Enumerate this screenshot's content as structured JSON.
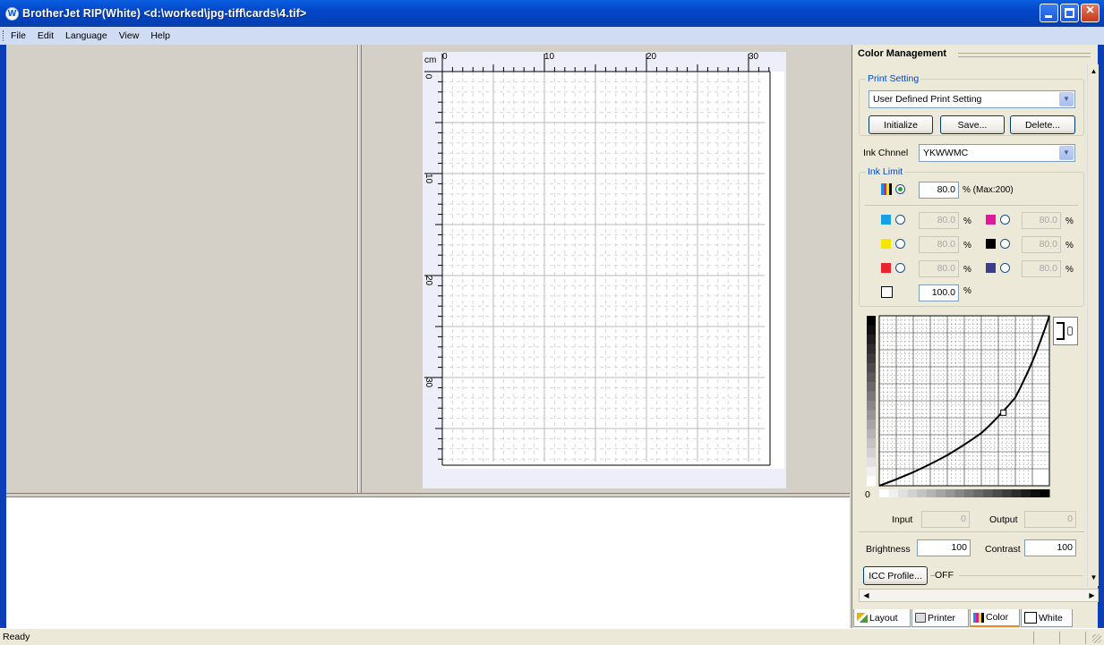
{
  "window": {
    "title": "BrotherJet RIP(White) <d:\\worked\\jpg-tiff\\cards\\4.tif>",
    "icon_letter": "W"
  },
  "menu": [
    "File",
    "Edit",
    "Language",
    "View",
    "Help"
  ],
  "ruler": {
    "unit": "cm",
    "top_labels": [
      "0",
      "10",
      "20",
      "30"
    ],
    "left_labels": [
      "0",
      "10",
      "20",
      "30"
    ]
  },
  "color_panel": {
    "title": "Color Management",
    "print_setting": {
      "label": "Print Setting",
      "selected": "User Defined Print Setting",
      "buttons": {
        "initialize": "Initialize",
        "save": "Save...",
        "delete": "Delete..."
      }
    },
    "ink_channel": {
      "label": "Ink Chnnel",
      "selected": "YKWWMC"
    },
    "ink_limit": {
      "label": "Ink Limit",
      "total_value": "80.0",
      "total_note": "% (Max:200)",
      "percent": "%",
      "cyan": "80.0",
      "magenta": "80.0",
      "yellow": "80.0",
      "black": "80.0",
      "red": "80.0",
      "blue": "80.0",
      "white": "100.0"
    },
    "curve": {
      "zero_label": "0",
      "points": [
        [
          0.0,
          0.0
        ],
        [
          0.2,
          0.08
        ],
        [
          0.4,
          0.18
        ],
        [
          0.6,
          0.31
        ],
        [
          0.72,
          0.43
        ],
        [
          0.8,
          0.52
        ],
        [
          0.9,
          0.73
        ],
        [
          1.0,
          1.0
        ]
      ],
      "control_point": [
        0.73,
        0.43
      ]
    },
    "input_label": "Input",
    "input_value": "0",
    "output_label": "Output",
    "output_value": "0",
    "brightness_label": "Brightness",
    "brightness_value": "100",
    "contrast_label": "Contrast",
    "contrast_value": "100",
    "icc_button": "ICC Profile...",
    "icc_state": "OFF"
  },
  "tabs": [
    "Layout",
    "Printer",
    "Color",
    "White"
  ],
  "status": {
    "text": "Ready"
  }
}
